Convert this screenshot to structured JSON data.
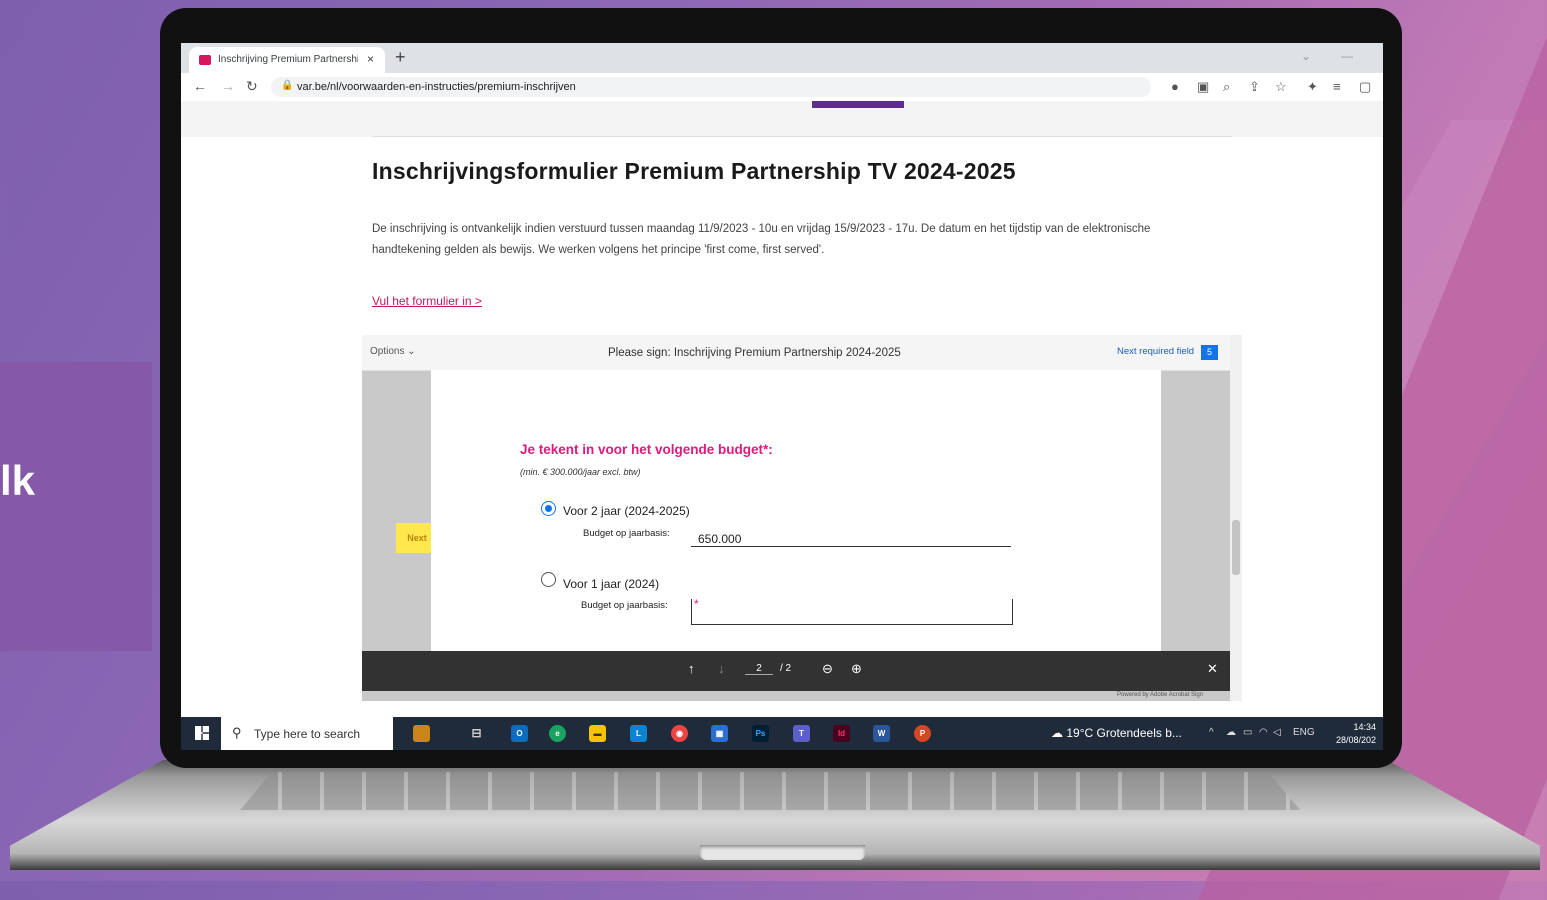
{
  "background": {
    "side_text": "lk"
  },
  "browser": {
    "tab_title": "Inschrijving Premium Partnership",
    "tab_close": "×",
    "new_tab": "+",
    "url": "var.be/nl/voorwaarden-en-instructies/premium-inschrijven"
  },
  "page": {
    "title": "Inschrijvingsformulier Premium Partnership TV 2024-2025",
    "description": "De inschrijving is ontvankelijk indien verstuurd tussen maandag 11/9/2023 - 10u en vrijdag 15/9/2023 - 17u. De datum en het tijdstip van de elektronische handtekening gelden als bewijs. We werken volgens het principe 'first come, first served'.",
    "fill_link": "Vul het formulier in >"
  },
  "sign": {
    "options": "Options ⌄",
    "title": "Please sign: Inschrijving Premium Partnership 2024-2025",
    "next_required": "Next required field",
    "next_required_count": "5",
    "budget_heading": "Je tekent in voor het volgende budget*:",
    "budget_min": "(min. € 300.000/jaar excl. btw)",
    "option1_label": "Voor 2 jaar (2024-2025)",
    "option1_selected": true,
    "field_label": "Budget op jaarbasis:",
    "option1_value": "650.000",
    "option2_label": "Voor 1 jaar (2024)",
    "option2_selected": false,
    "required_mark": "*",
    "next_tag": "Next",
    "page_current": "2",
    "page_total": "/ 2",
    "powered_by": "Powered by Adobe Acrobat Sign"
  },
  "taskbar": {
    "search_placeholder": "Type here to search",
    "weather": "19°C  Grotendeels b...",
    "lang": "ENG",
    "time": "14:34",
    "date": "28/08/202"
  }
}
